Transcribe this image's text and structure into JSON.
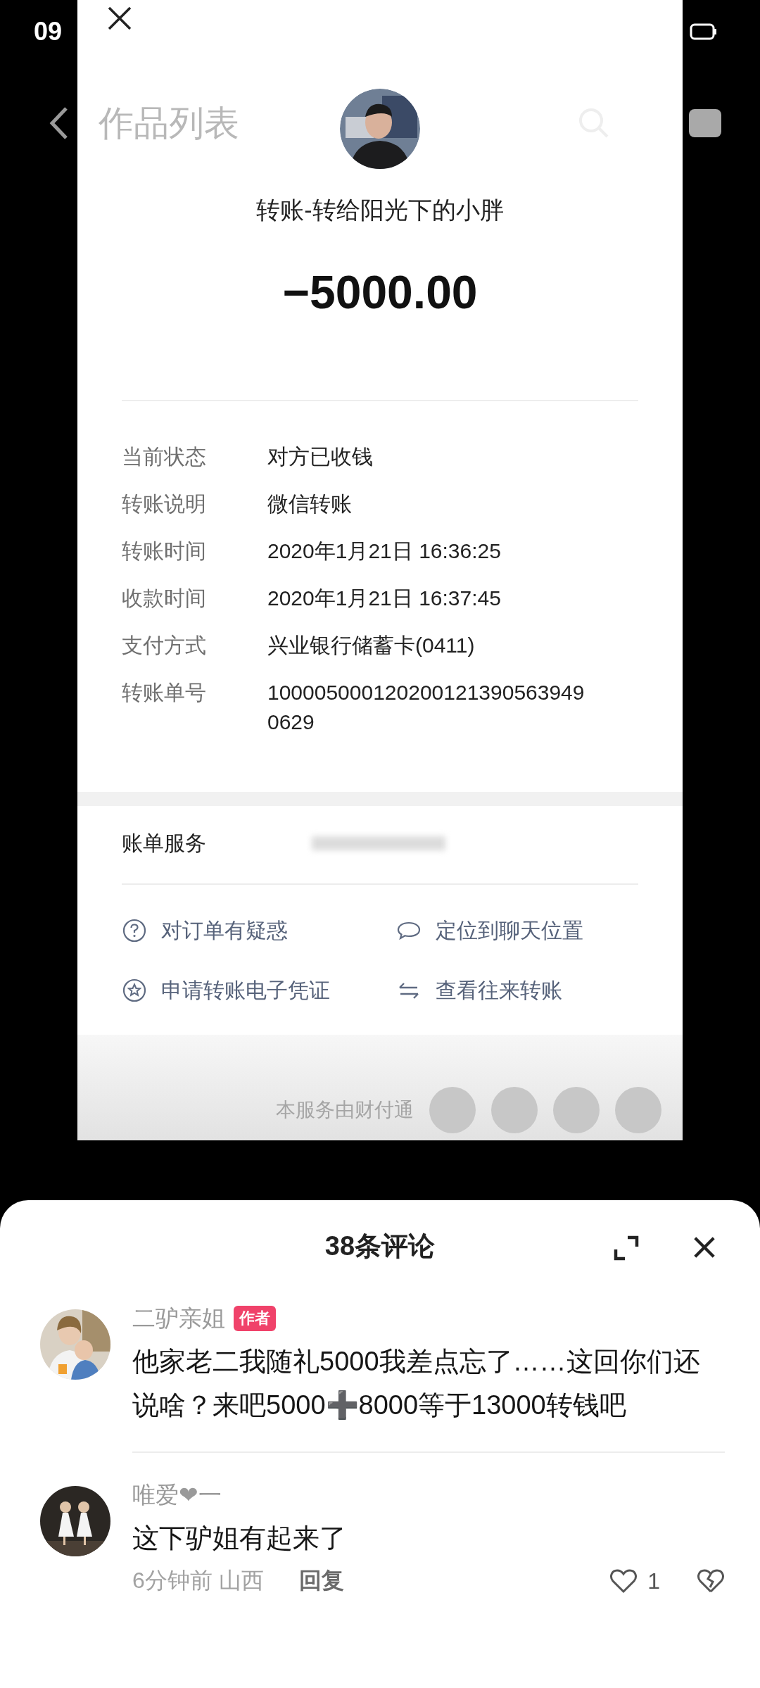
{
  "status_bar": {
    "time": "09"
  },
  "nav": {
    "title": "作品列表"
  },
  "receipt": {
    "title": "转账-转给阳光下的小胖",
    "amount": "−5000.00",
    "details": [
      {
        "label": "当前状态",
        "value": "对方已收钱"
      },
      {
        "label": "转账说明",
        "value": "微信转账"
      },
      {
        "label": "转账时间",
        "value": "2020年1月21日 16:36:25"
      },
      {
        "label": "收款时间",
        "value": "2020年1月21日 16:37:45"
      },
      {
        "label": "支付方式",
        "value": "兴业银行储蓄卡(0411)"
      },
      {
        "label": "转账单号",
        "value": "1000050001202001213905639490629"
      }
    ],
    "service_label": "账单服务",
    "actions": [
      {
        "kind": "question",
        "label": "对订单有疑惑"
      },
      {
        "kind": "chat",
        "label": "定位到聊天位置"
      },
      {
        "kind": "star",
        "label": "申请转账电子凭证"
      },
      {
        "kind": "swap",
        "label": "查看往来转账"
      }
    ],
    "footer": "本服务由财付通"
  },
  "comments": {
    "title": "38条评论",
    "items": [
      {
        "author": "二驴亲姐",
        "badge": "作者",
        "text": "他家老二我随礼5000我差点忘了……这回你们还说啥？来吧5000➕8000等于13000转钱吧"
      },
      {
        "author": "唯爱❤一",
        "text": "这下驴姐有起来了",
        "time": "6分钟前 山西",
        "reply": "回复",
        "likes": "1"
      }
    ]
  }
}
